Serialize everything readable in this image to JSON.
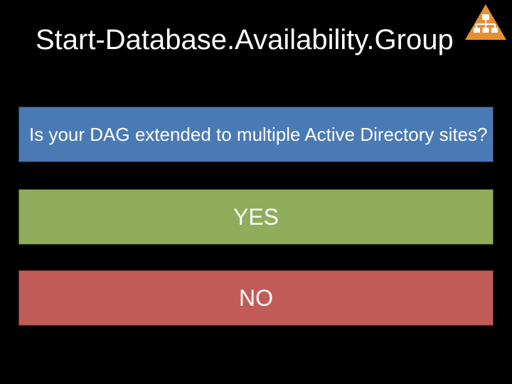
{
  "title": "Start-Database.Availability.Group",
  "question": "Is your DAG extended to multiple Active Directory sites?",
  "options": {
    "yes": "YES",
    "no": "NO"
  },
  "colors": {
    "background": "#000000",
    "question_bg": "#4a7ab5",
    "yes_bg": "#8fad5a",
    "no_bg": "#c15b58",
    "icon_bg": "#e8902f"
  }
}
